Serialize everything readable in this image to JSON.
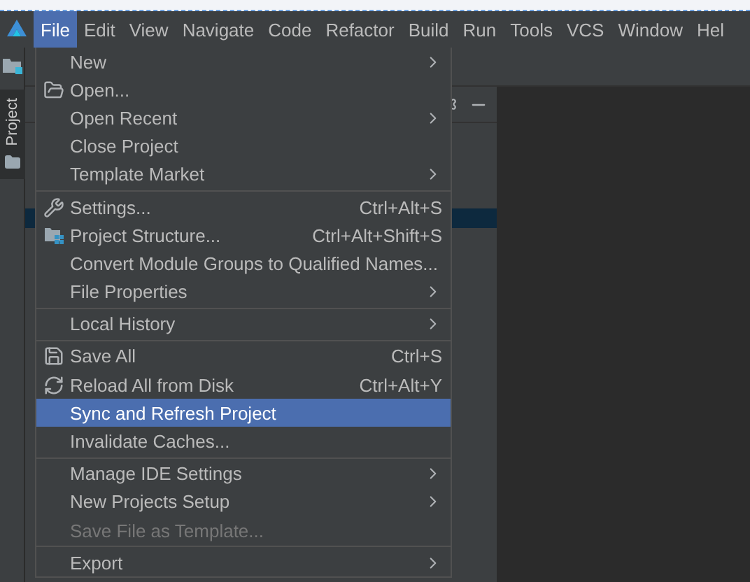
{
  "menu_bar": [
    {
      "label": "File",
      "selected": true
    },
    {
      "label": "Edit",
      "selected": false
    },
    {
      "label": "View",
      "selected": false
    },
    {
      "label": "Navigate",
      "selected": false
    },
    {
      "label": "Code",
      "selected": false
    },
    {
      "label": "Refactor",
      "selected": false
    },
    {
      "label": "Build",
      "selected": false
    },
    {
      "label": "Run",
      "selected": false
    },
    {
      "label": "Tools",
      "selected": false
    },
    {
      "label": "VCS",
      "selected": false
    },
    {
      "label": "Window",
      "selected": false
    },
    {
      "label": "Hel",
      "selected": false
    }
  ],
  "side_tab": {
    "label": "Project"
  },
  "file_menu": [
    [
      {
        "label": "New",
        "submenu": true,
        "selected": false,
        "disabled": false
      },
      {
        "label": "Open...",
        "kind": "folder-open",
        "selected": false,
        "disabled": false
      },
      {
        "label": "Open Recent",
        "submenu": true,
        "selected": false,
        "disabled": false
      },
      {
        "label": "Close Project",
        "selected": false,
        "disabled": false
      },
      {
        "label": "Template Market",
        "submenu": true,
        "selected": false,
        "disabled": false
      }
    ],
    [
      {
        "label": "Settings...",
        "kind": "wrench",
        "shortcut": "Ctrl+Alt+S",
        "selected": false,
        "disabled": false
      },
      {
        "label": "Project Structure...",
        "kind": "structure",
        "shortcut": "Ctrl+Alt+Shift+S",
        "selected": false,
        "disabled": false
      },
      {
        "label": "Convert Module Groups to Qualified Names...",
        "selected": false,
        "disabled": false
      },
      {
        "label": "File Properties",
        "submenu": true,
        "selected": false,
        "disabled": false
      }
    ],
    [
      {
        "label": "Local History",
        "submenu": true,
        "selected": false,
        "disabled": false
      }
    ],
    [
      {
        "label": "Save All",
        "kind": "save",
        "shortcut": "Ctrl+S",
        "selected": false,
        "disabled": false
      },
      {
        "label": "Reload All from Disk",
        "kind": "reload",
        "shortcut": "Ctrl+Alt+Y",
        "selected": false,
        "disabled": false
      },
      {
        "label": "Sync and Refresh Project",
        "selected": true,
        "disabled": false
      },
      {
        "label": "Invalidate Caches...",
        "selected": false,
        "disabled": false
      }
    ],
    [
      {
        "label": "Manage IDE Settings",
        "submenu": true,
        "selected": false,
        "disabled": false
      },
      {
        "label": "New Projects Setup",
        "submenu": true,
        "selected": false,
        "disabled": false
      },
      {
        "label": "Save File as Template...",
        "selected": false,
        "disabled": true
      }
    ],
    [
      {
        "label": "Export",
        "submenu": true,
        "selected": false,
        "disabled": false
      }
    ]
  ]
}
